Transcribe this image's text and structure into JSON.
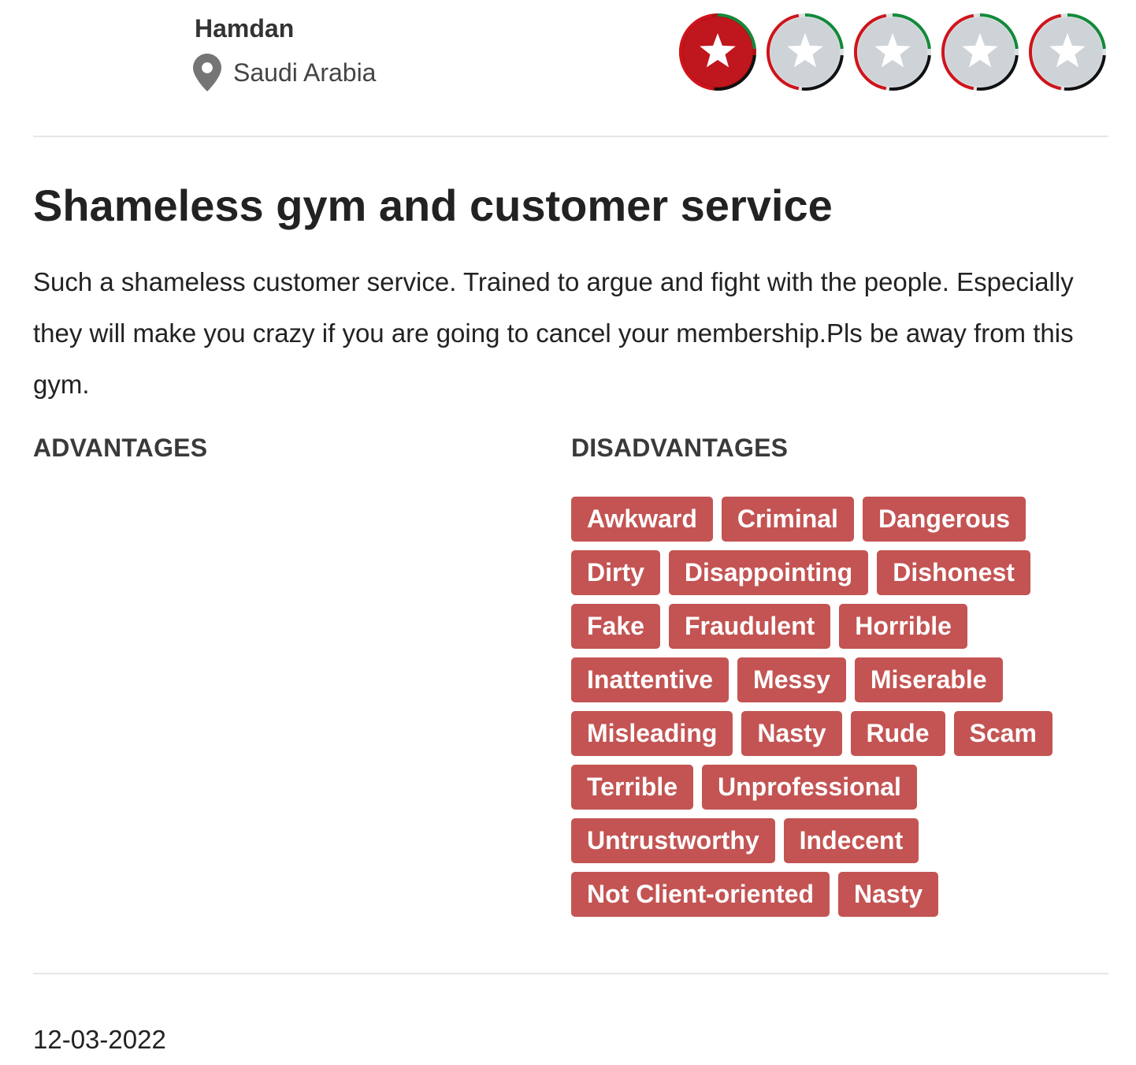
{
  "reviewer": {
    "name": "Hamdan",
    "location": "Saudi Arabia",
    "location_icon": "map-pin-icon"
  },
  "rating": {
    "value": 1,
    "max": 5,
    "icon": "star-icon",
    "filled_color": "#c0161d",
    "empty_color": "#ced3d8"
  },
  "review": {
    "title": "Shameless gym and customer service",
    "body": "Such a shameless customer service. Trained to argue and fight with the people. Especially they will make you crazy if you are going to cancel your membership.Pls be away from this gym.",
    "advantages_label": "ADVANTAGES",
    "disadvantages_label": "DISADVANTAGES",
    "disadvantages": [
      "Awkward",
      "Criminal",
      "Dangerous",
      "Dirty",
      "Disappointing",
      "Dishonest",
      "Fake",
      "Fraudulent",
      "Horrible",
      "Inattentive",
      "Messy",
      "Miserable",
      "Misleading",
      "Nasty",
      "Rude",
      "Scam",
      "Terrible",
      "Unprofessional",
      "Untrustworthy",
      "Indecent",
      "Not Client-oriented",
      "Nasty"
    ],
    "tag_color": "#c35453",
    "date": "12-03-2022"
  }
}
